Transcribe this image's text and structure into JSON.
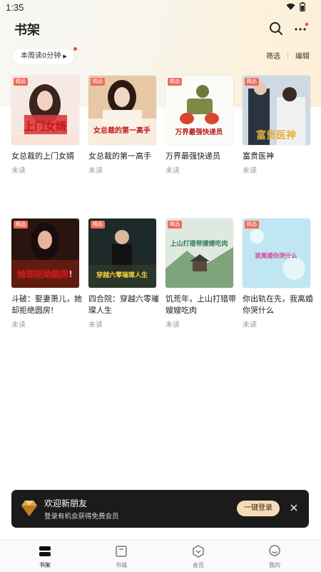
{
  "status_bar": {
    "time": "1:35"
  },
  "header": {
    "title": "书架"
  },
  "toolbar": {
    "read_time": "本周读0分钟",
    "filter": "筛选",
    "edit": "编辑"
  },
  "books": [
    {
      "title": "女总裁的上门女婿",
      "status": "未读",
      "tag": "精品"
    },
    {
      "title": "女总裁的第一高手",
      "status": "未读",
      "tag": "精品"
    },
    {
      "title": "万界最强快递员",
      "status": "未读",
      "tag": "精品"
    },
    {
      "title": "富贵医神",
      "status": "未读",
      "tag": "精品"
    },
    {
      "title": "斗破：娶妻萧儿，她却拒绝圆房!",
      "status": "未读",
      "tag": "精品"
    },
    {
      "title": "四合院：穿越六零璀璨人生",
      "status": "未读",
      "tag": "精品"
    },
    {
      "title": "饥荒年，上山打猎带嫂嫂吃肉",
      "status": "未读",
      "tag": "精品"
    },
    {
      "title": "你出轨在先，我离婚你哭什么",
      "status": "未读",
      "tag": "精品"
    }
  ],
  "covers": [
    {
      "text": "上门女婿"
    },
    {
      "text": "女总裁的第一高手"
    },
    {
      "text": "万界最强快递员"
    },
    {
      "text": "富贵医神"
    },
    {
      "text": "她却拒绝圆房!"
    },
    {
      "text": "穿越六零璀璨人生"
    },
    {
      "text": "上山打猎带嫂嫂吃肉"
    },
    {
      "text": "我离婚你哭什么"
    }
  ],
  "banner": {
    "title": "欢迎新朋友",
    "subtitle": "登录有机会获得免费会员",
    "login": "一键登录"
  },
  "tabs": [
    {
      "label": "书架"
    },
    {
      "label": "书城"
    },
    {
      "label": "会员"
    },
    {
      "label": "我的"
    }
  ],
  "colors": {
    "accent_red": "#f04c3c",
    "tag_bg": "#f06a5a",
    "banner_bg": "#1b1b1b",
    "login_bg": "#f3dcb7"
  }
}
